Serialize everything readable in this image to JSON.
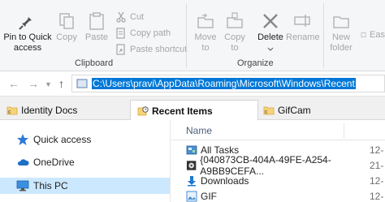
{
  "ribbon": {
    "clipboard": {
      "pin_label": "Pin to Quick access",
      "copy_label": "Copy",
      "paste_label": "Paste",
      "cut_label": "Cut",
      "copy_path_label": "Copy path",
      "paste_shortcut_label": "Paste shortcut",
      "group_label": "Clipboard"
    },
    "organize": {
      "move_to_label": "Move to",
      "copy_to_label": "Copy to",
      "delete_label": "Delete",
      "rename_label": "Rename",
      "group_label": "Organize"
    },
    "new": {
      "new_folder_label": "New folder",
      "partial_item_label": "Eas"
    }
  },
  "address_bar": {
    "path": "C:\\Users\\pravi\\AppData\\Roaming\\Microsoft\\Windows\\Recent"
  },
  "tabs": [
    {
      "label": "Identity Docs",
      "active": false
    },
    {
      "label": "Recent Items",
      "active": true
    },
    {
      "label": "GifCam",
      "active": false
    }
  ],
  "nav_pane": {
    "items": [
      {
        "label": "Quick access",
        "icon": "star-icon"
      },
      {
        "label": "OneDrive",
        "icon": "cloud-icon"
      },
      {
        "label": "This PC",
        "icon": "computer-icon"
      }
    ]
  },
  "content": {
    "column_name": "Name",
    "rows": [
      {
        "name": "All Tasks",
        "date": "12-",
        "icon": "control-panel-icon"
      },
      {
        "name": "{040873CB-404A-49FE-A254-A9BB9CEFA...",
        "date": "21-",
        "icon": "media-icon"
      },
      {
        "name": "Downloads",
        "date": "12-",
        "icon": "download-arrow-icon"
      },
      {
        "name": "GIF",
        "date": "12-",
        "icon": "image-icon"
      }
    ]
  },
  "colors": {
    "selection_blue": "#0078d7",
    "nav_selected": "#cce8ff",
    "delete_red": "#c42b1c"
  }
}
